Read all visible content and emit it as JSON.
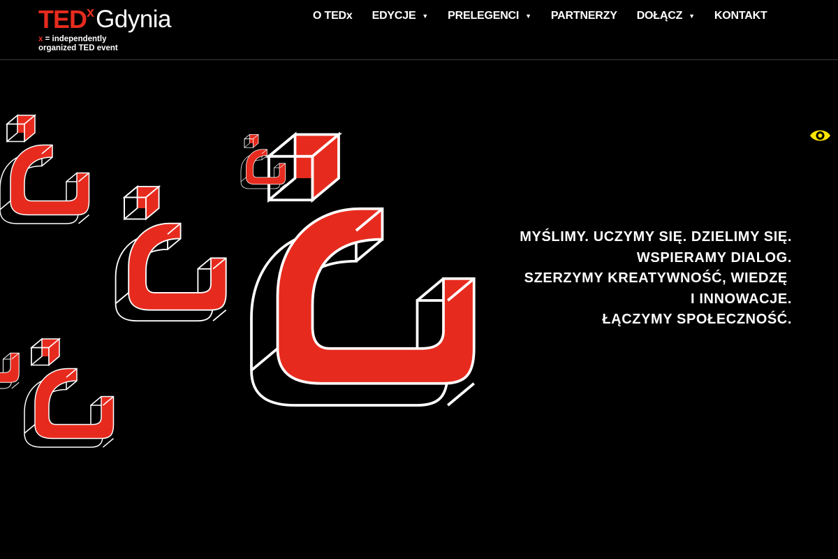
{
  "header": {
    "logo": {
      "ted": "TED",
      "x": "x",
      "city": "Gdynia",
      "tag_x": "x",
      "tag_rest": " = independently",
      "tag_line2": "organized TED event"
    },
    "nav": [
      {
        "label": "O TEDx",
        "has_dropdown": false
      },
      {
        "label": "EDYCJE",
        "has_dropdown": true
      },
      {
        "label": "PRELEGENCI",
        "has_dropdown": true
      },
      {
        "label": "PARTNERZY",
        "has_dropdown": false
      },
      {
        "label": "DOŁĄCZ",
        "has_dropdown": true
      },
      {
        "label": "KONTAKT",
        "has_dropdown": false
      }
    ],
    "caret": "▼"
  },
  "hero": {
    "tagline": [
      "MYŚLIMY. UCZYMY SIĘ. DZIELIMY SIĘ.",
      "WSPIERAMY DIALOG.",
      "SZERZYMY KREATYWNOŚĆ, WIEDZĘ ",
      "I INNOWACJE.",
      "ŁĄCZYMY SPOŁECZNOŚĆ."
    ]
  },
  "icons": {
    "accessibility": "eye-icon",
    "art": "question-mark-shape"
  },
  "colors": {
    "background": "#000000",
    "brand_red": "#e62b1e",
    "eye_yellow": "#ffe500"
  }
}
